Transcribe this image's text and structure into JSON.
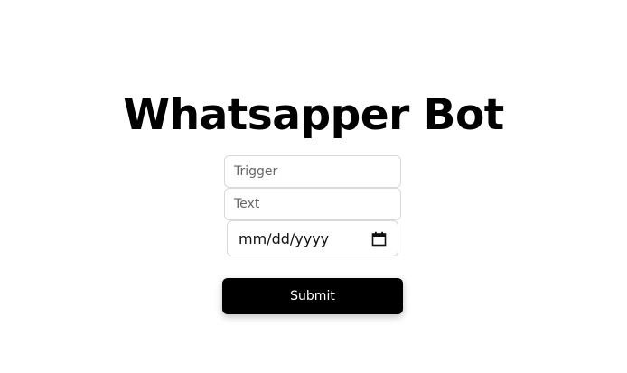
{
  "page": {
    "title": "Whatsapper Bot"
  },
  "form": {
    "trigger": {
      "placeholder": "Trigger",
      "value": ""
    },
    "text": {
      "placeholder": "Text",
      "value": ""
    },
    "date": {
      "placeholder": "mm/dd/yyyy",
      "icon": "calendar-icon"
    },
    "submit_label": "Submit"
  },
  "colors": {
    "button_bg": "#000000",
    "button_text": "#ffffff",
    "border": "#d9d9d9"
  }
}
